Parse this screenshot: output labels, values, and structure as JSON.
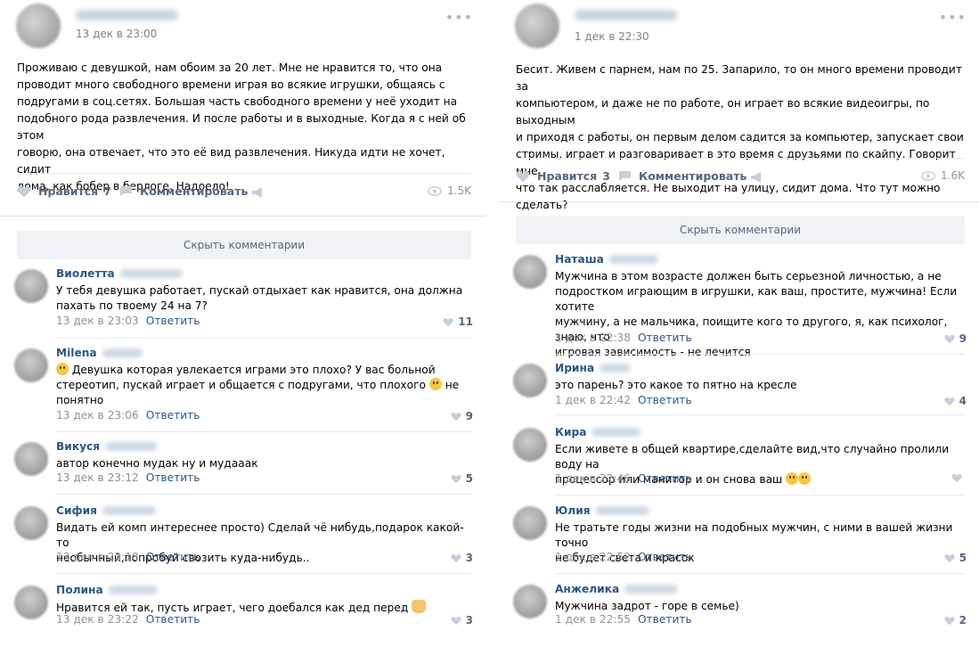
{
  "left": {
    "date": "13 дек в 23:00",
    "text": "Проживаю с девушкой, нам обоим за 20 лет. Мне не нравится то, что она\nпроводит много свободного времени играя во всякие игрушки, общаясь с\nподругами в соц.сетях. Большая часть свободного времени у неё уходит на\nподобного рода развлечения. И после работы и в выходные. Когда я с ней об этом\nговорю, она отвечает, что это её вид развлечения. Никуда идти не хочет, сидит\nдома, как бобер в берлоге. Надоело!",
    "like_label": "Нравится",
    "like_count": "7",
    "comment_label": "Комментировать",
    "views": "1.5K",
    "hide_comments": "Скрыть комментарии",
    "comments": [
      {
        "name": "Виолетта",
        "text": "У тебя девушка работает, пускай отдыхает как нравится, она должна\nпахать по твоему 24 на 7?",
        "date": "13 дек в 23:03",
        "reply": "Ответить",
        "likes": "11"
      },
      {
        "name": "Milena",
        "text_a": "Девушка которая увлекается играми это плохо? У вас больной\nстереотип, пускай играет и общается с подругами, что плохого",
        "text_b": "не\nпонятно",
        "date": "13 дек в 23:06",
        "reply": "Ответить",
        "likes": "9"
      },
      {
        "name": "Викуся",
        "text": "автор конечно мудак ну и мудааак",
        "date": "13 дек в 23:12",
        "reply": "Ответить",
        "likes": "5"
      },
      {
        "name": "Сифия",
        "text": "Видать ей комп интереснее просто) Сделай чё нибудь,подарок какой-то\nнеобычный,попробуй свозить куда-нибудь..",
        "date": "13 дек в 23:18",
        "reply": "Ответить",
        "likes": "3"
      },
      {
        "name": "Полина",
        "text": "Нравится ей так, пусть играет, чего доебался как дед перед",
        "date": "13 дек в 23:22",
        "reply": "Ответить",
        "likes": "3"
      }
    ]
  },
  "right": {
    "date": "1 дек в 22:30",
    "text": "Бесит. Живем с парнем, нам по 25. Запарило, то он много времени проводит за\nкомпьютером, и даже не по работе, он играет во всякие видеоигры, по выходным\nи приходя с работы, он первым делом садится за компьютер, запускает свои\nстримы, играет и разговаривает в это время с друзьями по скайпу. Говорит мне,\nчто так расслабляется. Не выходит на улицу, сидит дома. Что тут можно сделать?",
    "like_label": "Нравится",
    "like_count": "3",
    "comment_label": "Комментировать",
    "views": "1.6K",
    "hide_comments": "Скрыть комментарии",
    "comments": [
      {
        "name": "Наташа",
        "text": "Мужчина в этом возрасте должен быть серьезной личностью, а не\nподростком играющим в игрушки, как ваш, простите, мужчина! Если хотите\nмужчину, а не мальчика, поищите кого то другого, я, как психолог, знаю, что\nигровая зависимость - не лечится",
        "date": "1 дек в 22:38",
        "reply": "Ответить",
        "likes": "9"
      },
      {
        "name": "Ирина",
        "text": "это парень? это какое то пятно на кресле",
        "date": "1 дек в 22:42",
        "reply": "Ответить",
        "likes": "4"
      },
      {
        "name": "Кира",
        "text": "Если живете в общей квартире,сделайте вид,что случайно пролили воду на\nпроцессор или манитор и он снова ваш",
        "date": "1 дек в 22:46",
        "reply": "Ответить",
        "likes": ""
      },
      {
        "name": "Юлия",
        "text": "Не тратьте годы жизни на подобных мужчин, с ними в вашей жизни точно\nне будет света и красок",
        "date": "1 дек в 22:52",
        "reply": "Ответить",
        "likes": "5"
      },
      {
        "name": "Анжелика",
        "text": "Мужчина задрот - горе в семье)",
        "date": "1 дек в 22:55",
        "reply": "Ответить",
        "likes": "2"
      }
    ]
  },
  "colors": {
    "link": "#2a5885",
    "muted": "#939393",
    "action": "#55677d",
    "button_bg": "#f0f2f5"
  },
  "icons": [
    "more-icon",
    "heart-icon",
    "comment-icon",
    "share-icon",
    "eye-icon",
    "emoji-icon"
  ]
}
